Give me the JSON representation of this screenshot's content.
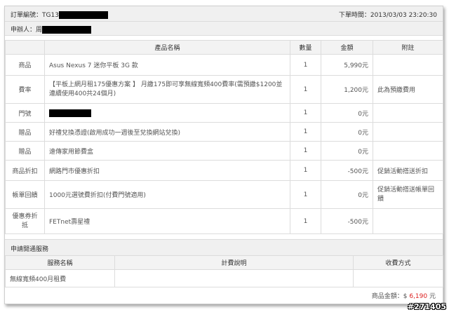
{
  "order": {
    "number_label": "訂單編號：TG13",
    "time_label": "下單時間：2013/03/03 23:20:30",
    "applicant_label": "申辦人：周"
  },
  "products": {
    "headers": [
      "產品名稱",
      "數量",
      "金額",
      "附註"
    ],
    "rows": [
      {
        "cat": "商品",
        "name": "Asus Nexus 7 迷你平板 3G 款",
        "qty": "1",
        "amount": "5,990元",
        "note": ""
      },
      {
        "cat": "費率",
        "name": "【平板上網月租175優惠方案 】 月繳175即可享無線寬頻400費率(需預繳$1200並連續使用400共24個月)",
        "qty": "1",
        "amount": "1,200元",
        "note": "此為預繳費用"
      },
      {
        "cat": "門號",
        "name": "",
        "qty": "1",
        "amount": "0元",
        "note": ""
      },
      {
        "cat": "贈品",
        "name": "好禮兌換憑證(啟用成功一週後至兌換網站兌換)",
        "qty": "1",
        "amount": "0元",
        "note": ""
      },
      {
        "cat": "贈品",
        "name": "遠傳家用節費盒",
        "qty": "1",
        "amount": "0元",
        "note": ""
      },
      {
        "cat": "商品折扣",
        "name": "網路門市優惠折扣",
        "qty": "1",
        "amount": "-500元",
        "note": "促銷活動搭送折扣"
      },
      {
        "cat": "帳單回饋",
        "name": "1000元選號費折扣(付費門號適用)",
        "qty": "1",
        "amount": "0元",
        "note": "促銷活動搭送帳單回饋"
      },
      {
        "cat": "優惠券折抵",
        "name": "FETnet壽星禮",
        "qty": "1",
        "amount": "-500元",
        "note": ""
      }
    ]
  },
  "services": {
    "title": "申請開通服務",
    "headers": [
      "服務名稱",
      "計費說明",
      "收費方式"
    ],
    "rows": [
      {
        "name": "無線寬頻400月租費",
        "billing": "",
        "method": ""
      }
    ]
  },
  "total": {
    "label": "商品金額：$",
    "amount": "6,190",
    "unit": "元"
  },
  "watermark": "#271405"
}
